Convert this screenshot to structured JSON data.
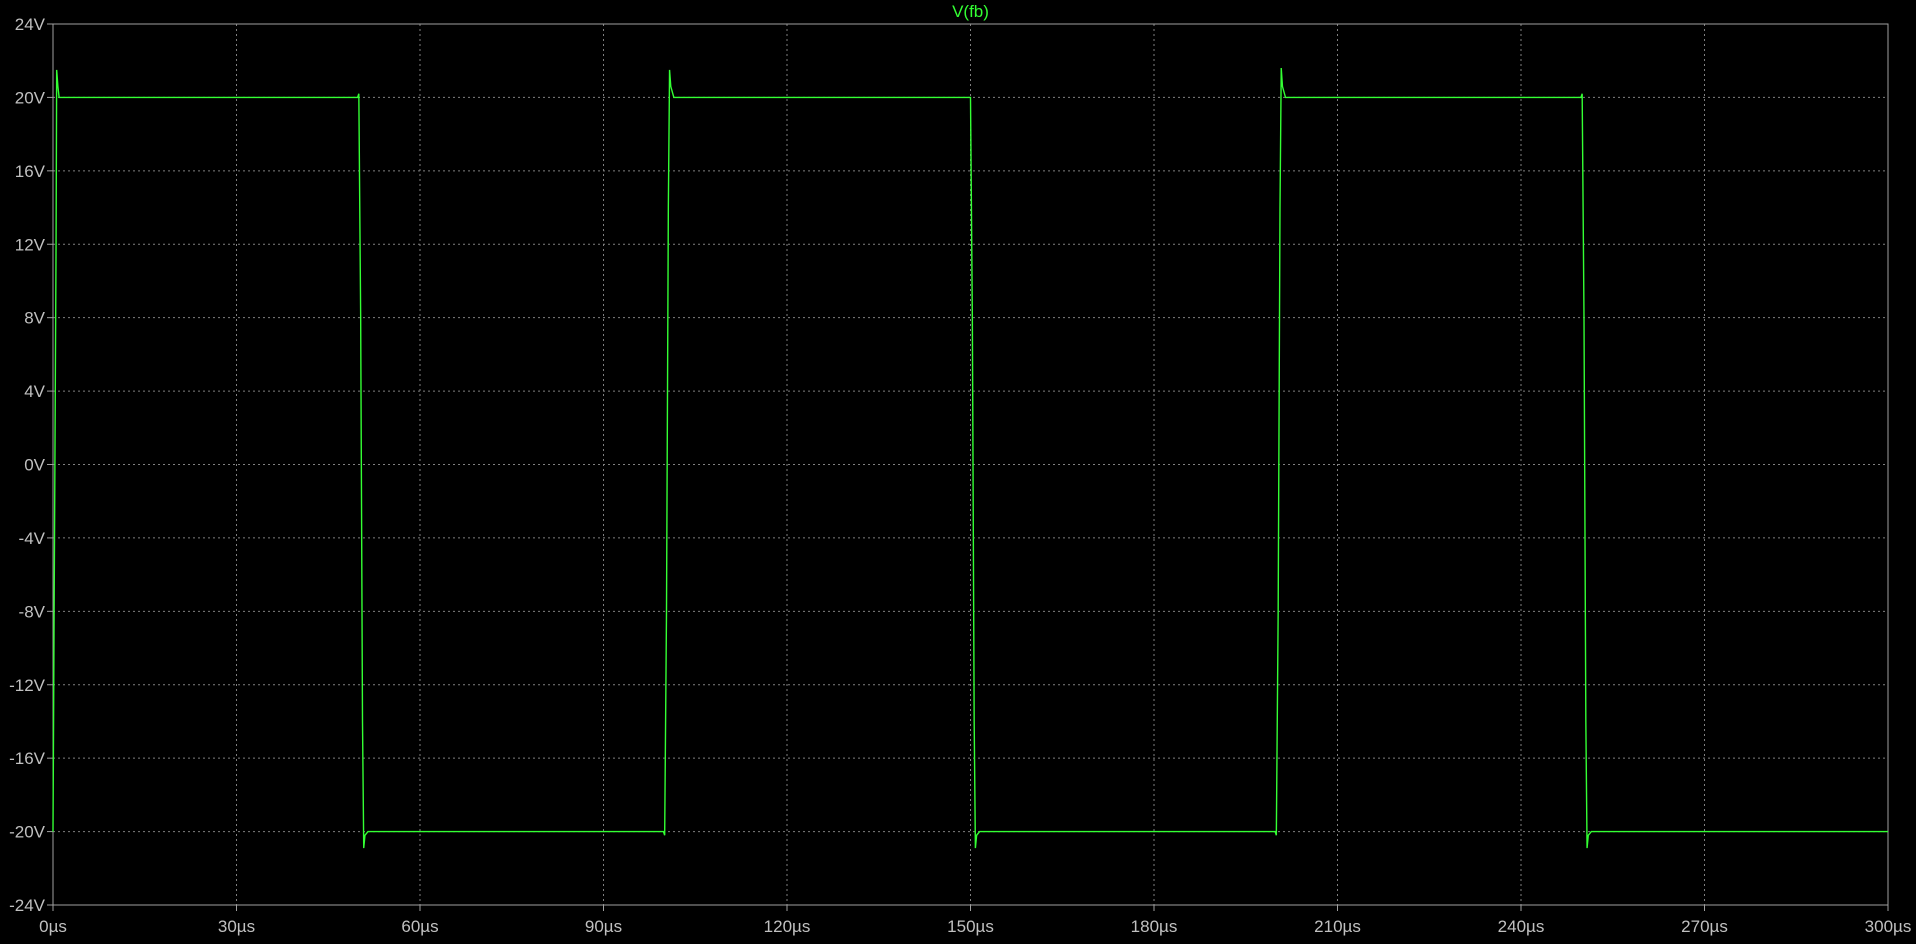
{
  "window": {
    "background": "#000000"
  },
  "chart_data": {
    "type": "line",
    "title": "",
    "xlabel": "",
    "ylabel": "",
    "xlim": [
      0,
      300
    ],
    "ylim": [
      -24,
      24
    ],
    "x_unit": "µs",
    "y_unit": "V",
    "grid": true,
    "grid_style": "dotted",
    "axis_color": "#a0a0a0",
    "grid_color": "#808080",
    "label_color": "#c0c0c0",
    "x_ticks": [
      0,
      30,
      60,
      90,
      120,
      150,
      180,
      210,
      240,
      270,
      300
    ],
    "x_tick_labels": [
      "0µs",
      "30µs",
      "60µs",
      "90µs",
      "120µs",
      "150µs",
      "180µs",
      "210µs",
      "240µs",
      "270µs",
      "300µs"
    ],
    "y_ticks": [
      24,
      20,
      16,
      12,
      8,
      4,
      0,
      -4,
      -8,
      -12,
      -16,
      -20,
      -24
    ],
    "y_tick_labels": [
      "24V",
      "20V",
      "16V",
      "12V",
      "8V",
      "4V",
      "0V",
      "-4V",
      "-8V",
      "-12V",
      "-16V",
      "-20V",
      "-24V"
    ],
    "series": [
      {
        "name": "V(fb)",
        "color": "#33ff33",
        "x": [
          0,
          0.2,
          0.5,
          0.6,
          0.8,
          1.0,
          1.5,
          49.8,
          50.0,
          50.3,
          50.6,
          50.8,
          51.0,
          51.5,
          99.8,
          100.0,
          100.3,
          100.6,
          100.8,
          101.0,
          101.5,
          149.8,
          150.0,
          150.3,
          150.6,
          150.8,
          151.0,
          151.5,
          199.8,
          200.0,
          200.3,
          200.6,
          200.8,
          201.0,
          201.5,
          249.8,
          250.0,
          250.3,
          250.6,
          250.8,
          251.0,
          251.5,
          300.0
        ],
        "y": [
          -20,
          -7,
          12,
          21.5,
          20.6,
          20,
          20,
          20,
          20.2,
          8,
          -14,
          -20.9,
          -20.2,
          -20,
          -20,
          -20.2,
          -8,
          14,
          21.5,
          20.6,
          20,
          20,
          20,
          8,
          -14,
          -20.9,
          -20.2,
          -20,
          -20,
          -20.2,
          -8,
          14,
          21.6,
          20.6,
          20,
          20,
          20.2,
          8,
          -14,
          -20.9,
          -20.2,
          -20,
          -20
        ]
      }
    ]
  }
}
